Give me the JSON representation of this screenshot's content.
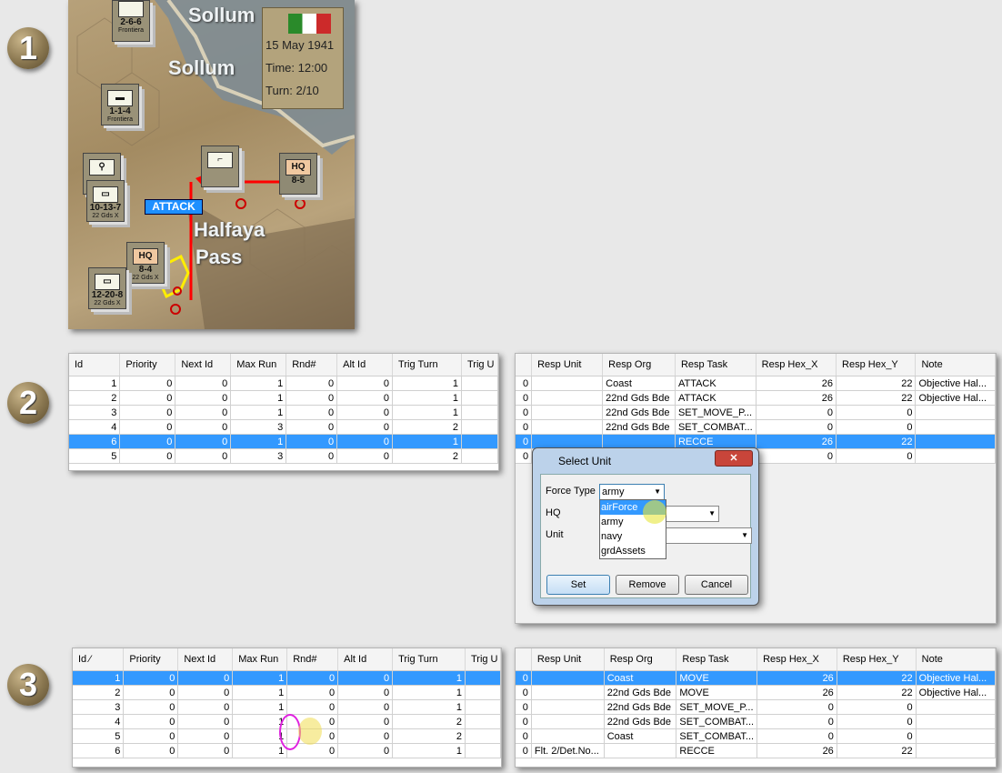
{
  "steps": [
    "1",
    "2",
    "3"
  ],
  "map": {
    "places": [
      "Sollum",
      "Sollum",
      "Halfaya",
      "Pass"
    ],
    "info": {
      "date": "15 May 1941",
      "time": "Time: 12:00",
      "turn": "Turn: 2/10"
    },
    "attack_label": "ATTACK",
    "counters": [
      {
        "top": "",
        "box": "",
        "value": "2-6-6",
        "sub": "Frontiera"
      },
      {
        "top": "I",
        "box": "",
        "value": "1-1-4",
        "sub": "Frontiera"
      },
      {
        "top": "",
        "box": "",
        "value": "",
        "sub": ""
      },
      {
        "top": "",
        "box": "",
        "value": "10-13-7",
        "sub": "22 Gds X"
      },
      {
        "top": "",
        "box": "HQ",
        "value": "8-5",
        "sub": ""
      },
      {
        "top": "",
        "box": "",
        "value": "",
        "sub": ""
      },
      {
        "top": "",
        "box": "HQ",
        "value": "8-4",
        "sub": "22 Gds X"
      },
      {
        "top": "",
        "box": "",
        "value": "12-20-8",
        "sub": "22 Gds X"
      }
    ]
  },
  "left_table": {
    "headers": [
      "Id",
      "Priority",
      "Next Id",
      "Max Run",
      "Rnd#",
      "Alt Id",
      "Trig Turn",
      "Trig U"
    ]
  },
  "right_table": {
    "headers": [
      "",
      "Resp Unit",
      "Resp Org",
      "Resp Task",
      "Resp Hex_X",
      "Resp Hex_Y",
      "Note"
    ]
  },
  "table2_left_rows": [
    [
      "1",
      "0",
      "0",
      "1",
      "0",
      "0",
      "1"
    ],
    [
      "2",
      "0",
      "0",
      "1",
      "0",
      "0",
      "1"
    ],
    [
      "3",
      "0",
      "0",
      "1",
      "0",
      "0",
      "1"
    ],
    [
      "4",
      "0",
      "0",
      "3",
      "0",
      "0",
      "2"
    ],
    [
      "6",
      "0",
      "0",
      "1",
      "0",
      "0",
      "1"
    ],
    [
      "5",
      "0",
      "0",
      "3",
      "0",
      "0",
      "2"
    ]
  ],
  "table2_left_selected": 4,
  "table2_right_rows": [
    [
      "0",
      "",
      "Coast",
      "ATTACK",
      "26",
      "22",
      "Objective Hal..."
    ],
    [
      "0",
      "",
      "22nd Gds Bde",
      "ATTACK",
      "26",
      "22",
      "Objective Hal..."
    ],
    [
      "0",
      "",
      "22nd Gds Bde",
      "SET_MOVE_P...",
      "0",
      "0",
      ""
    ],
    [
      "0",
      "",
      "22nd Gds Bde",
      "SET_COMBAT...",
      "0",
      "0",
      ""
    ],
    [
      "0",
      "",
      "",
      "RECCE",
      "26",
      "22",
      ""
    ],
    [
      "0",
      "",
      "",
      "",
      "0",
      "0",
      ""
    ]
  ],
  "table2_right_selected": 4,
  "dialog": {
    "title": "Select Unit",
    "close": "✕",
    "force_type_label": "Force Type",
    "force_type_value": "army",
    "hq_label": "HQ",
    "unit_label": "Unit",
    "options": [
      "airForce",
      "army",
      "navy",
      "grdAssets"
    ],
    "set": "Set",
    "remove": "Remove",
    "cancel": "Cancel"
  },
  "table3_left_header_first": "Id ⁄",
  "table3_left_rows": [
    [
      "1",
      "0",
      "0",
      "1",
      "0",
      "0",
      "1"
    ],
    [
      "2",
      "0",
      "0",
      "1",
      "0",
      "0",
      "1"
    ],
    [
      "3",
      "0",
      "0",
      "1",
      "0",
      "0",
      "1"
    ],
    [
      "4",
      "0",
      "0",
      "1",
      "0",
      "0",
      "2"
    ],
    [
      "5",
      "0",
      "0",
      "1",
      "0",
      "0",
      "2"
    ],
    [
      "6",
      "0",
      "0",
      "1",
      "0",
      "0",
      "1"
    ]
  ],
  "table3_left_selected": 0,
  "table3_right_rows": [
    [
      "0",
      "",
      "Coast",
      "MOVE",
      "26",
      "22",
      "Objective Hal..."
    ],
    [
      "0",
      "",
      "22nd Gds Bde",
      "MOVE",
      "26",
      "22",
      "Objective Hal..."
    ],
    [
      "0",
      "",
      "22nd Gds Bde",
      "SET_MOVE_P...",
      "0",
      "0",
      ""
    ],
    [
      "0",
      "",
      "22nd Gds Bde",
      "SET_COMBAT...",
      "0",
      "0",
      ""
    ],
    [
      "0",
      "",
      "Coast",
      "SET_COMBAT...",
      "0",
      "0",
      ""
    ],
    [
      "0",
      "Flt. 2/Det.No...",
      "",
      "RECCE",
      "26",
      "22",
      ""
    ]
  ],
  "table3_right_selected": 0
}
